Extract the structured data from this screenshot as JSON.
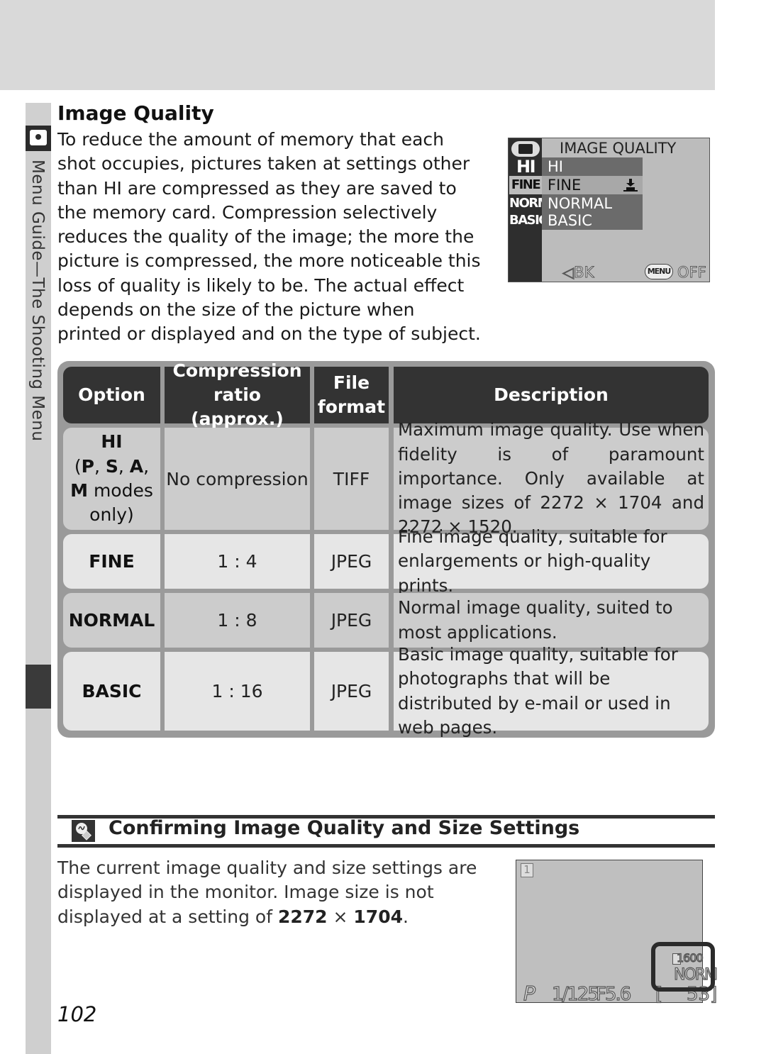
{
  "page": {
    "number": "102",
    "side_tab_label": "Menu Guide—The Shooting Menu"
  },
  "section": {
    "title": "Image Quality",
    "intro": "To reduce the amount of memory that each shot occupies, pictures taken at settings other than HI are compressed as they are saved to the memory card.  Compression selectively reduces the quality of the image; the more the picture is compressed, the more noticeable this loss of quality is likely to be.  The actual effect depends on the size of the picture when printed or displayed and on the type of subject."
  },
  "camera_menu": {
    "title": "IMAGE QUALITY",
    "selected_index": 1,
    "items": [
      {
        "code": "HI",
        "label": "HI"
      },
      {
        "code": "FINE",
        "label": "FINE"
      },
      {
        "code": "NORM",
        "label": "NORMAL"
      },
      {
        "code": "BASIC",
        "label": "BASIC"
      }
    ],
    "back_label": "BK",
    "menu_button": "MENU",
    "off_label": "OFF"
  },
  "table": {
    "headers": {
      "option": "Option",
      "compression_line1": "Compression",
      "compression_line2": "ratio (approx.)",
      "format_line1": "File",
      "format_line2": "format",
      "description": "Description"
    },
    "rows": [
      {
        "option": "HI",
        "option_note_p": "P",
        "option_note_s": "S",
        "option_note_a": "A",
        "option_note_m": "M",
        "option_note_modes": " modes",
        "option_note_only": "only)",
        "compression": "No compression",
        "format": "TIFF",
        "description": "Maximum image quality.  Use when fidelity is of paramount importance.  Only available at image sizes of 2272 × 1704 and 2272 × 1520."
      },
      {
        "option": "FINE",
        "compression": "1 : 4",
        "format": "JPEG",
        "description": "Fine image quality, suitable for enlargements or high-quality prints."
      },
      {
        "option": "NORMAL",
        "compression": "1 : 8",
        "format": "JPEG",
        "description": "Normal image quality, suited to most applications."
      },
      {
        "option": "BASIC",
        "compression": "1 : 16",
        "format": "JPEG",
        "description": "Basic image quality, suitable for photographs that will be distributed by e-mail or used in web pages."
      }
    ]
  },
  "tip": {
    "icon": "lightbulb-icon",
    "title": "Confirming Image Quality and Size Settings",
    "text_before": "The current image quality and size settings are displayed in the monitor.  Image size is not displayed at a setting of ",
    "size_w": "2272",
    "times": " × ",
    "size_h": "1704",
    "text_after": "."
  },
  "monitor": {
    "frame_indicator": "1",
    "mode": "P",
    "shutter": "1/125",
    "aperture": "F5.6",
    "bracket": "[",
    "exposures_remaining": "53]",
    "image_size": "1600",
    "quality": "NORM"
  }
}
